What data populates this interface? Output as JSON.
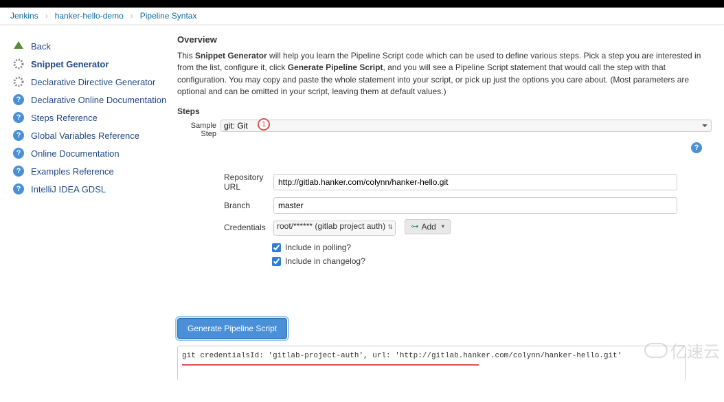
{
  "breadcrumb": {
    "a": "Jenkins",
    "b": "hanker-hello-demo",
    "c": "Pipeline Syntax"
  },
  "sidebar": {
    "items": [
      {
        "label": "Back"
      },
      {
        "label": "Snippet Generator"
      },
      {
        "label": "Declarative Directive Generator"
      },
      {
        "label": "Declarative Online Documentation"
      },
      {
        "label": "Steps Reference"
      },
      {
        "label": "Global Variables Reference"
      },
      {
        "label": "Online Documentation"
      },
      {
        "label": "Examples Reference"
      },
      {
        "label": "IntelliJ IDEA GDSL"
      }
    ]
  },
  "overview": {
    "heading": "Overview",
    "p1a": "This ",
    "p1b": "Snippet Generator",
    "p1c": " will help you learn the Pipeline Script code which can be used to define various steps. Pick a step you are interested in from the list, configure it, click ",
    "p1d": "Generate Pipeline Script",
    "p1e": ", and you will see a Pipeline Script statement that would call the step with that configuration. You may copy and paste the whole statement into your script, or pick up just the options you care about. (Most parameters are optional and can be omitted in your script, leaving them at default values.)"
  },
  "steps": {
    "heading": "Steps",
    "sample_label": "Sample Step",
    "sample_value": "git: Git",
    "badge": "1",
    "repo_label": "Repository URL",
    "repo_value": "http://gitlab.hanker.com/colynn/hanker-hello.git",
    "branch_label": "Branch",
    "branch_value": "master",
    "cred_label": "Credentials",
    "cred_value": "root/****** (gitlab project auth)",
    "add_label": "Add",
    "polling_label": "Include in polling?",
    "changelog_label": "Include in changelog?"
  },
  "generate": {
    "button": "Generate Pipeline Script",
    "output": "git credentialsId: 'gitlab-project-auth', url: 'http://gitlab.hanker.com/colynn/hanker-hello.git'"
  },
  "watermark": "亿速云"
}
